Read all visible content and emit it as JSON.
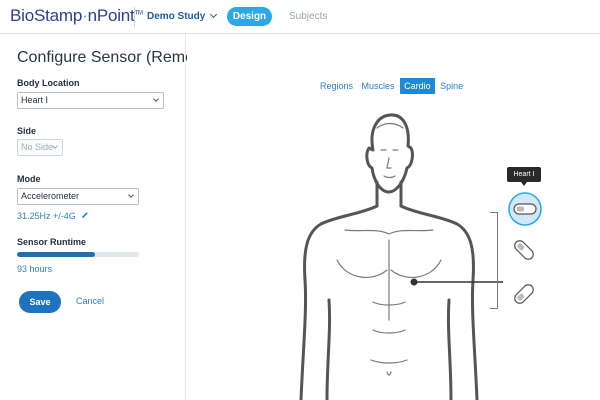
{
  "header": {
    "logo_text": "BioStamp",
    "logo_text_2": "nPoint",
    "logo_tm": "TM",
    "study_label": "Demo Study",
    "nav": [
      {
        "label": "Design",
        "active": true
      },
      {
        "label": "Subjects",
        "active": false
      }
    ]
  },
  "form": {
    "title": "Configure Sensor (Remote)",
    "body_location": {
      "label": "Body Location",
      "value": "Heart I"
    },
    "side": {
      "label": "Side",
      "value": "No Side",
      "disabled": true
    },
    "mode": {
      "label": "Mode",
      "value": "Accelerometer",
      "rate": "31.25Hz +/-4G"
    },
    "runtime": {
      "label": "Sensor Runtime",
      "value": "93 hours",
      "fraction": 0.64
    },
    "save_label": "Save",
    "cancel_label": "Cancel"
  },
  "body_view": {
    "tabs": [
      {
        "label": "Regions",
        "active": false
      },
      {
        "label": "Muscles",
        "active": false
      },
      {
        "label": "Cardio",
        "active": true
      },
      {
        "label": "Spine",
        "active": false
      }
    ],
    "tooltip": "Heart I",
    "sensor_options": [
      "horizontal",
      "diagonal-down",
      "diagonal-up"
    ],
    "selected_sensor": "horizontal"
  },
  "colors": {
    "brand": "#2a3f8f",
    "accent": "#2ba8e5",
    "primary_button": "#1e73be",
    "link": "#2f7fc1",
    "active_tab": "#1c8ad6"
  },
  "icons": [
    "chevron-down-icon",
    "pencil-icon",
    "sensor-icon"
  ]
}
